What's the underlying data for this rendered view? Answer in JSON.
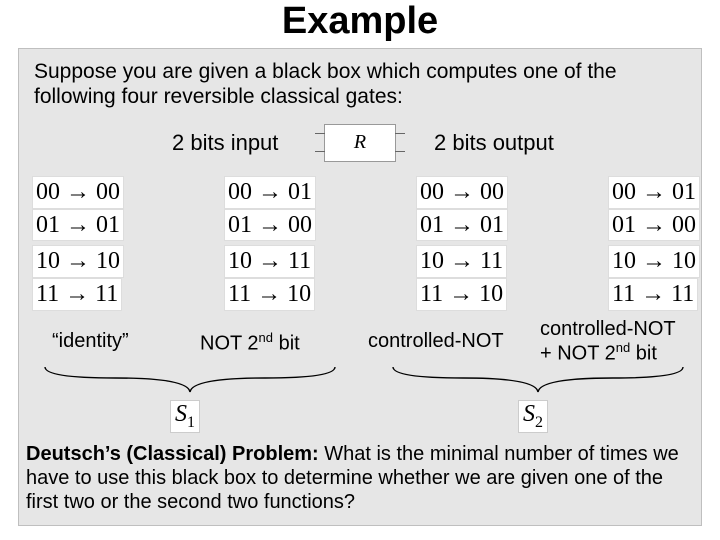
{
  "title": "Example",
  "intro": "Suppose you are given a black box which computes one of the following four reversible classical gates:",
  "io": {
    "input": "2 bits input",
    "output": "2 bits output",
    "boxlabel": "R"
  },
  "gates": [
    {
      "rows": [
        "00 → 00",
        "01 → 01",
        "10 → 10",
        "11 → 11"
      ],
      "label": "“identity”"
    },
    {
      "rows": [
        "00 → 01",
        "01 → 00",
        "10 → 11",
        "11 → 10"
      ],
      "label_pre": "NOT 2",
      "label_sup": "nd",
      "label_post": " bit"
    },
    {
      "rows": [
        "00 → 00",
        "01 → 01",
        "10 → 11",
        "11 → 10"
      ],
      "label": "controlled-NOT"
    },
    {
      "rows": [
        "00 → 01",
        "01 → 00",
        "10 → 10",
        "11 → 11"
      ],
      "label_line1": "controlled-NOT",
      "label_line2_pre": "+ NOT 2",
      "label_line2_sup": "nd",
      "label_line2_post": " bit"
    }
  ],
  "sets": {
    "s1": "S",
    "s1sub": "1",
    "s2": "S",
    "s2sub": "2"
  },
  "problem_label": "Deutsch’s (Classical) Problem:",
  "problem_text": " What is the minimal number of times we have to use this black box to determine whether we are given one of the first two or the second two functions?"
}
